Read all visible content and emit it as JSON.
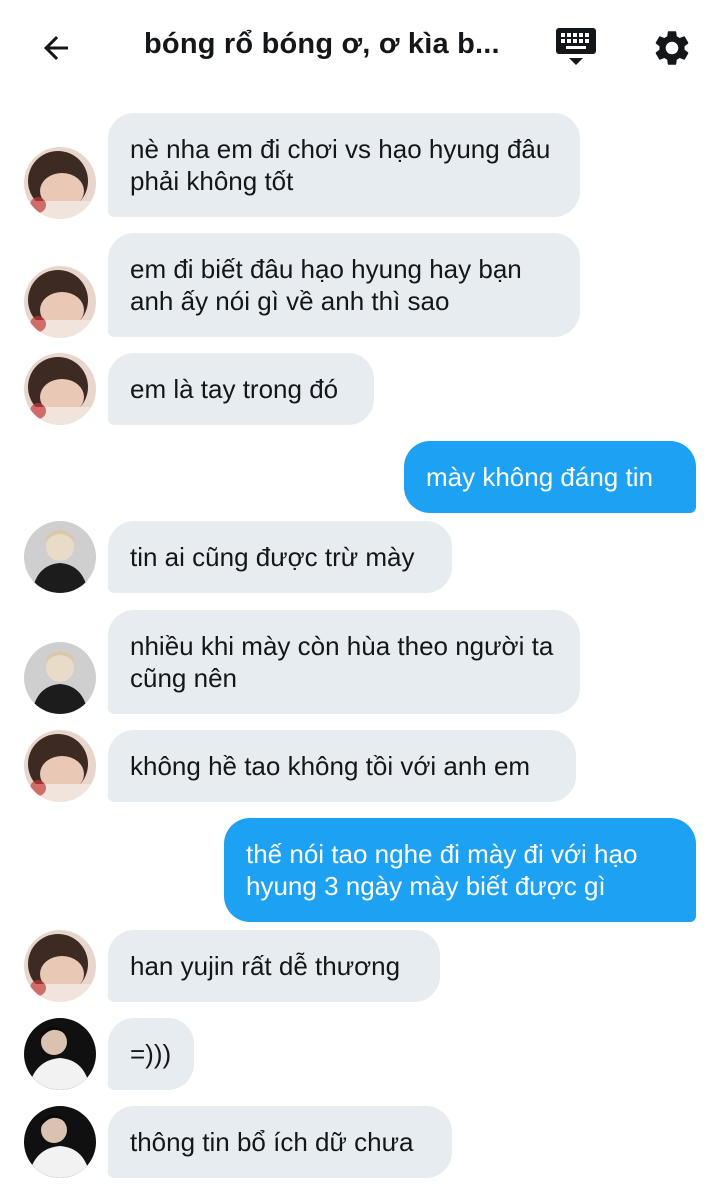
{
  "header": {
    "title": "bóng rổ bóng ơ, ơ kìa b...",
    "back_icon": "arrow-left-icon",
    "keyboard_icon": "keyboard-icon",
    "settings_icon": "gear-icon"
  },
  "colors": {
    "incoming_bubble": "#e6ecf0",
    "outgoing_bubble": "#1da1f2",
    "text_dark": "#14171a"
  },
  "messages": [
    {
      "direction": "in",
      "sender": "a",
      "text": "nè nha em đi chơi vs hạo hyung đâu phải không tốt"
    },
    {
      "direction": "in",
      "sender": "a",
      "text": "em đi biết đâu hạo hyung hay bạn anh ấy nói gì về anh thì sao"
    },
    {
      "direction": "in",
      "sender": "a",
      "text": "em là tay trong đó"
    },
    {
      "direction": "out",
      "text": "mày không đáng tin"
    },
    {
      "direction": "in",
      "sender": "b",
      "text": "tin ai cũng được trừ mày"
    },
    {
      "direction": "in",
      "sender": "b",
      "text": "nhiều khi mày còn hùa theo người ta cũng nên"
    },
    {
      "direction": "in",
      "sender": "a",
      "text": "không hề tao không tồi với anh em"
    },
    {
      "direction": "out",
      "text": "thế nói tao nghe đi mày đi với hạo hyung 3 ngày mày biết được gì"
    },
    {
      "direction": "in",
      "sender": "a",
      "text": "han yujin rất dễ thương"
    },
    {
      "direction": "in",
      "sender": "c",
      "text": "=)))"
    },
    {
      "direction": "in",
      "sender": "c",
      "text": "thông tin bổ ích dữ chưa"
    }
  ]
}
